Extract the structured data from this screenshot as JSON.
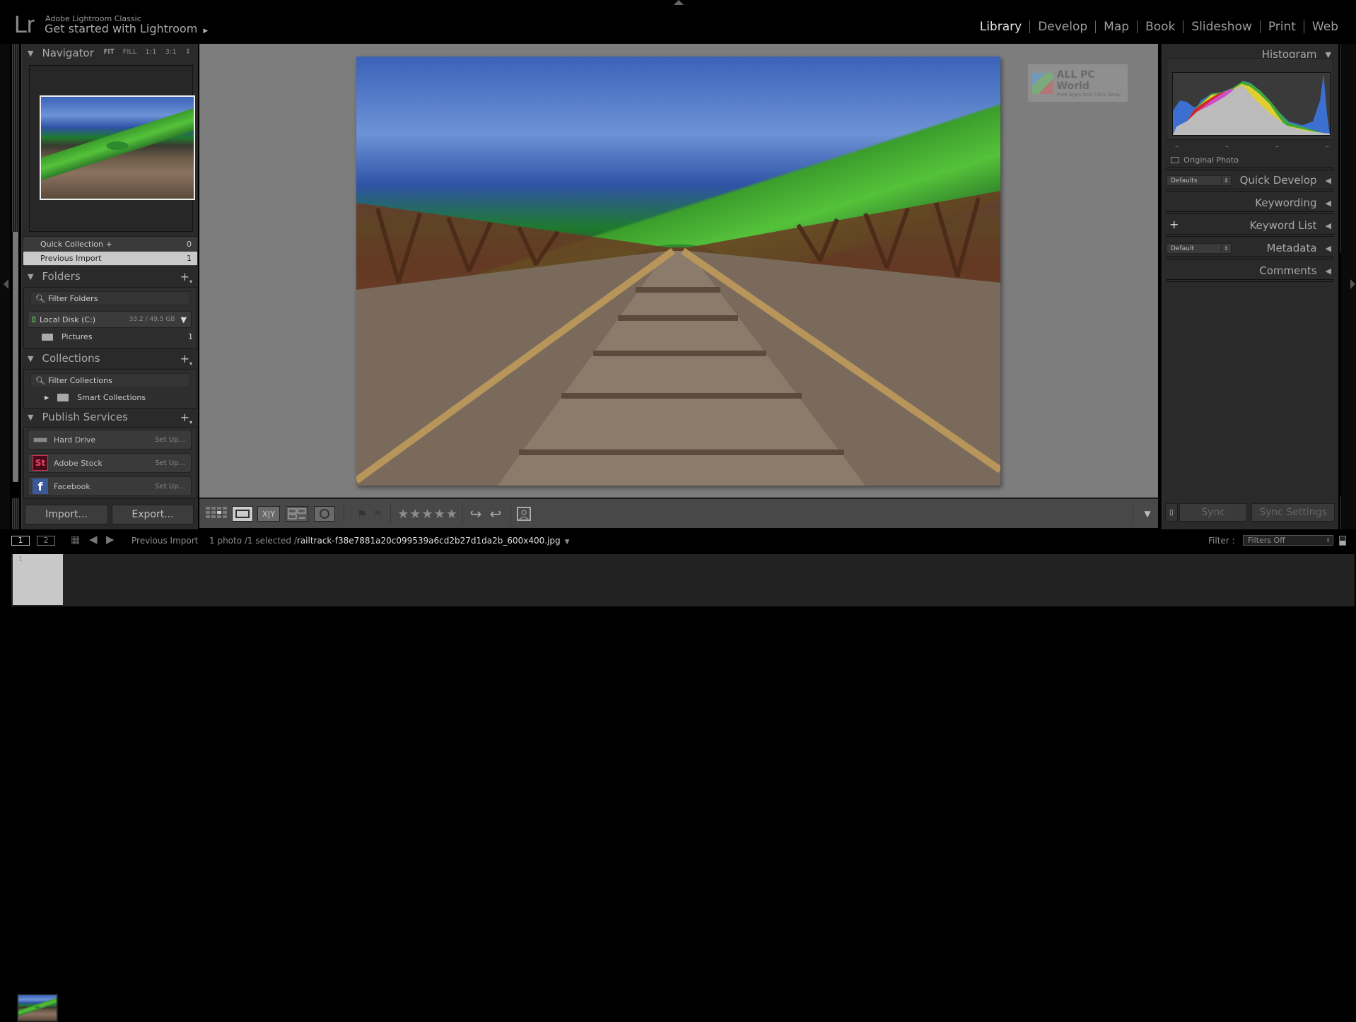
{
  "app": {
    "logo": "Lr",
    "product": "Adobe Lightroom Classic",
    "title": "Get started with Lightroom",
    "title_arrow": "▶"
  },
  "modules": [
    {
      "label": "Library",
      "active": true
    },
    {
      "label": "Develop",
      "active": false
    },
    {
      "label": "Map",
      "active": false
    },
    {
      "label": "Book",
      "active": false
    },
    {
      "label": "Slideshow",
      "active": false
    },
    {
      "label": "Print",
      "active": false
    },
    {
      "label": "Web",
      "active": false
    }
  ],
  "left": {
    "navigator": {
      "label": "Navigator",
      "zoom_options": [
        "FIT",
        "FILL",
        "1:1",
        "3:1"
      ],
      "active_zoom": "FIT"
    },
    "catalog": [
      {
        "label": "Quick Collection +",
        "count": "0"
      },
      {
        "label": "Previous Import",
        "count": "1",
        "selected": true
      }
    ],
    "folders": {
      "label": "Folders",
      "filter_placeholder": "Filter Folders",
      "volume": {
        "name": "Local Disk (C:)",
        "size": "33.2 / 49.5 GB"
      },
      "items": [
        {
          "name": "Pictures",
          "count": "1"
        }
      ]
    },
    "collections": {
      "label": "Collections",
      "filter_placeholder": "Filter Collections",
      "items": [
        {
          "name": "Smart Collections"
        }
      ]
    },
    "publish": {
      "label": "Publish Services",
      "services": [
        {
          "name": "Hard Drive",
          "action": "Set Up..."
        },
        {
          "name": "Adobe Stock",
          "action": "Set Up...",
          "icon_text": "St"
        },
        {
          "name": "Facebook",
          "action": "Set Up...",
          "icon_text": "f"
        }
      ]
    },
    "import_label": "Import...",
    "export_label": "Export..."
  },
  "center": {
    "watermark": {
      "title": "ALL PC World",
      "tagline": "Free Apps One Click Away"
    },
    "toolbar": {
      "rating_stars": "★★★★★",
      "views": [
        "grid-view",
        "loupe-view",
        "compare-view",
        "survey-view",
        "people-view"
      ]
    }
  },
  "right": {
    "histogram": {
      "label": "Histogram",
      "original_photo": "Original Photo",
      "ticks": [
        "–",
        "–",
        "–",
        "–"
      ]
    },
    "quick_develop": {
      "label": "Quick Develop",
      "preset": "Defaults"
    },
    "keywording": {
      "label": "Keywording"
    },
    "keyword_list": {
      "label": "Keyword List"
    },
    "metadata": {
      "label": "Metadata",
      "preset": "Default"
    },
    "comments": {
      "label": "Comments"
    },
    "sync_label": "Sync",
    "sync_settings_label": "Sync Settings"
  },
  "filmstrip": {
    "monitor1": "1",
    "monitor2": "2",
    "source": "Previous Import",
    "count_text": "1 photo /1 selected /",
    "filename": "railtrack-f38e7881a20c099539a6cd2b27d1da2b_600x400.jpg",
    "filter_label": "Filter :",
    "filter_value": "Filters Off",
    "thumb_index": "1"
  },
  "colors": {
    "panel_bg": "#2a2a2a",
    "canvas_bg": "#7d7d7d",
    "toolbar_bg": "#484848",
    "selected_row": "#c9c9c9",
    "adobe_stock": "#4a0a18",
    "facebook": "#3b5998"
  }
}
